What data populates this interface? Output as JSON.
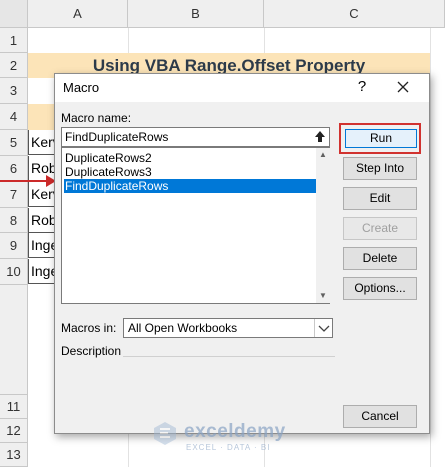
{
  "spreadsheet": {
    "columns": [
      "A",
      "B",
      "C"
    ],
    "rows": [
      "1",
      "2",
      "3",
      "4",
      "5",
      "6",
      "7",
      "8",
      "9",
      "10",
      "11",
      "12",
      "13"
    ],
    "title": "Using VBA Range.Offset Property",
    "cells": [
      "Kerv",
      "Rob",
      "Kerv",
      "Rob",
      "Inge",
      "Inge"
    ]
  },
  "dialog": {
    "title": "Macro",
    "help_icon": "?",
    "macro_name_label": "Macro name:",
    "macro_name_value": "FindDuplicateRows",
    "macros": [
      "DuplicateRows2",
      "DuplicateRows3",
      "FindDuplicateRows"
    ],
    "selected_index": 2,
    "buttons": {
      "run": "Run",
      "step_into": "Step Into",
      "edit": "Edit",
      "create": "Create",
      "delete": "Delete",
      "options": "Options...",
      "cancel": "Cancel"
    },
    "macros_in_label": "Macros in:",
    "macros_in_value": "All Open Workbooks",
    "description_label": "Description"
  },
  "watermark": {
    "name": "exceldemy",
    "tagline": "EXCEL · DATA · BI"
  },
  "colors": {
    "highlight": "#d1322f",
    "selection": "#0078d7",
    "title_band": "#fce4b8"
  }
}
